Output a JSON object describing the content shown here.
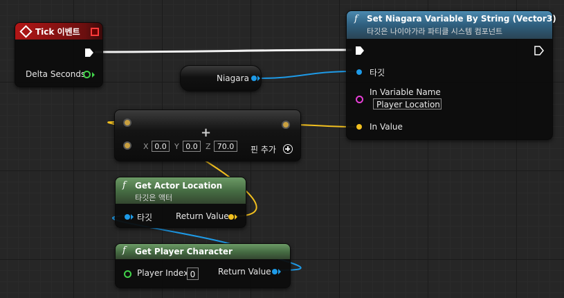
{
  "tick_node": {
    "title": "Tick 이벤트",
    "output": "Delta Seconds"
  },
  "niagara_node": {
    "label": "Niagara"
  },
  "set_var_node": {
    "title": "Set Niagara Variable By String (Vector3)",
    "subtitle": "타깃은 나이아가라 파티클 시스템 컴포넌트",
    "pin_target": "타깃",
    "pin_var_name": "In Variable Name",
    "var_name_value": "Player Location",
    "pin_in_value": "In Value"
  },
  "add_node": {
    "x_label": "X",
    "x_value": "0.0",
    "y_label": "Y",
    "y_value": "0.0",
    "z_label": "Z",
    "z_value": "70.0",
    "add_pin_label": "핀 추가",
    "plus_symbol": "+"
  },
  "get_actor_node": {
    "title": "Get Actor Location",
    "subtitle": "타깃은 액터",
    "pin_target": "타깃",
    "pin_return": "Return Value"
  },
  "get_player_node": {
    "title": "Get Player Character",
    "pin_index": "Player Index",
    "index_value": "0",
    "pin_return": "Return Value"
  },
  "colors": {
    "object_pin": "#1e9be8",
    "vector_pin": "#f2c01f",
    "name_pin": "#e83fd7",
    "float_pin": "#42d34a",
    "event_header": "#a31212",
    "function_header": "#3f6f8e",
    "pure_header": "#4a6e46"
  }
}
